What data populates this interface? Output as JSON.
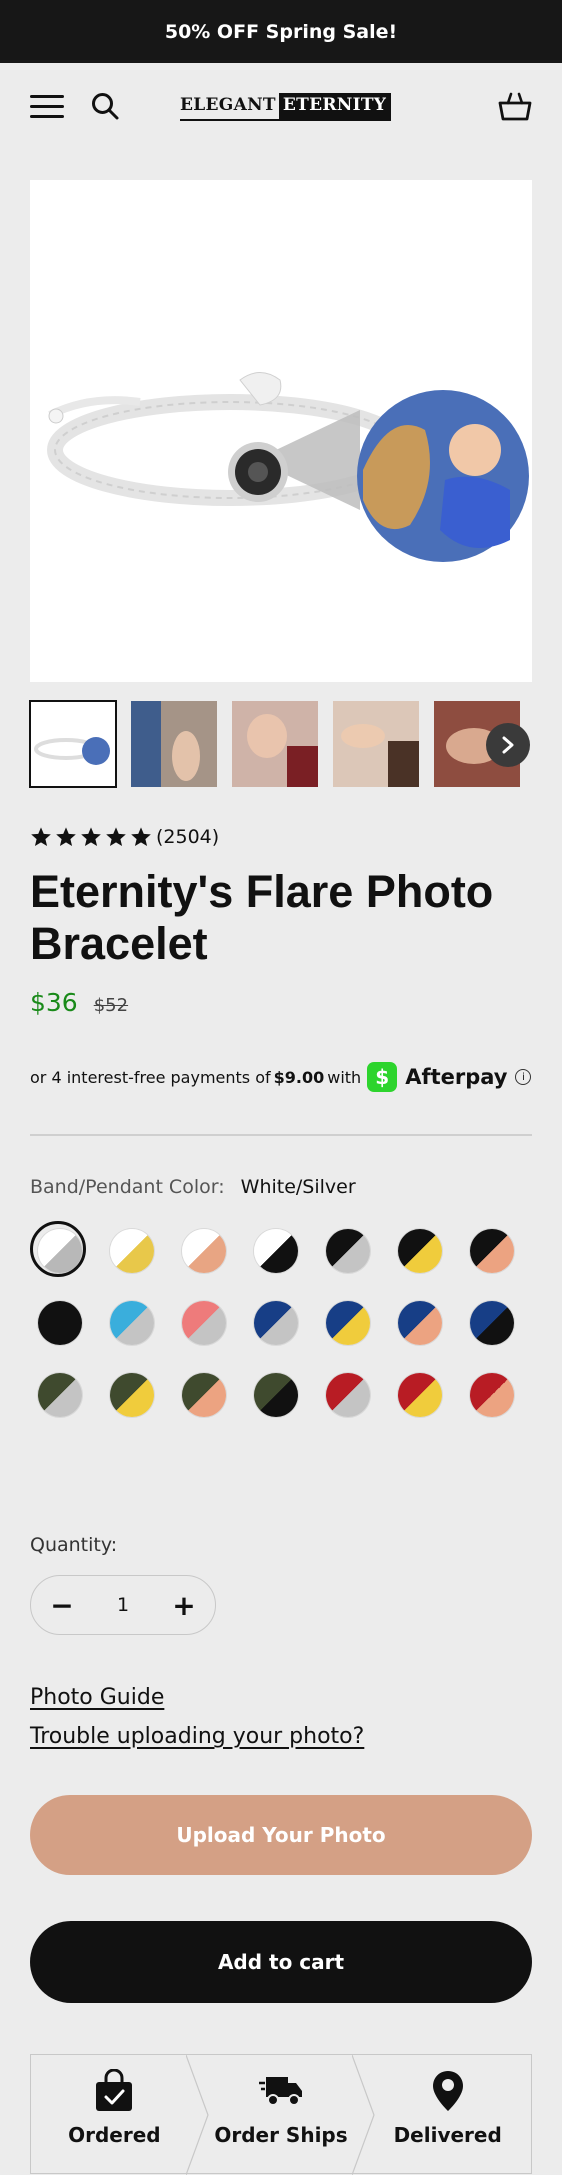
{
  "announcement": "50% OFF Spring Sale!",
  "header": {
    "logo_part1": "ELEGANT",
    "logo_part2": "ETERNITY",
    "icons": [
      "menu-icon",
      "search-icon",
      "cart-icon"
    ]
  },
  "product": {
    "rating_stars": 5,
    "review_count": "(2504)",
    "title": "Eternity's Flare Photo Bracelet",
    "price": "$36",
    "compare_price": "$52"
  },
  "afterpay": {
    "text_before": "or 4 interest-free payments of",
    "amount": "$9.00",
    "text_with": "with",
    "badge_symbol": "$",
    "brand": "Afterpay",
    "info_symbol": "i"
  },
  "option": {
    "label": "Band/Pendant Color:",
    "selected_value": "White/Silver",
    "swatches": [
      {
        "c1": "#ffffff",
        "c2": "#b8b8b8"
      },
      {
        "c1": "#ffffff",
        "c2": "#e8c84a"
      },
      {
        "c1": "#ffffff",
        "c2": "#e8a583"
      },
      {
        "c1": "#ffffff",
        "c2": "#111111"
      },
      {
        "c1": "#111111",
        "c2": "#c4c4c4"
      },
      {
        "c1": "#111111",
        "c2": "#f0cc3c"
      },
      {
        "c1": "#111111",
        "c2": "#eca381"
      },
      {
        "c1": "#111111",
        "c2": "#111111"
      },
      {
        "c1": "#3aaedc",
        "c2": "#c4c4c4"
      },
      {
        "c1": "#ee7b7b",
        "c2": "#c4c4c4"
      },
      {
        "c1": "#173e86",
        "c2": "#c4c4c4"
      },
      {
        "c1": "#173e86",
        "c2": "#f0cc3c"
      },
      {
        "c1": "#173e86",
        "c2": "#eca381"
      },
      {
        "c1": "#173e86",
        "c2": "#111111"
      },
      {
        "c1": "#3f4a2e",
        "c2": "#c4c4c4"
      },
      {
        "c1": "#3f4a2e",
        "c2": "#f0cc3c"
      },
      {
        "c1": "#3f4a2e",
        "c2": "#eca381"
      },
      {
        "c1": "#3f4a2e",
        "c2": "#111111"
      },
      {
        "c1": "#b81c24",
        "c2": "#c4c4c4"
      },
      {
        "c1": "#b81c24",
        "c2": "#f0cc3c"
      },
      {
        "c1": "#b81c24",
        "c2": "#eca381"
      }
    ]
  },
  "quantity": {
    "label": "Quantity:",
    "value": "1",
    "minus": "−",
    "plus": "+"
  },
  "links": {
    "photo_guide": "Photo Guide",
    "trouble": "Trouble uploading your photo?"
  },
  "buttons": {
    "upload": "Upload Your Photo",
    "add_to_cart": "Add to cart"
  },
  "steps": [
    {
      "label": "Ordered",
      "icon": "shopping-bag-check-icon"
    },
    {
      "label": "Order Ships",
      "icon": "delivery-truck-icon"
    },
    {
      "label": "Delivered",
      "icon": "map-pin-icon"
    }
  ],
  "colors": {
    "announcement_bg": "#171717",
    "page_bg": "#ececec",
    "price_green": "#1a8a1a",
    "upload_button": "#d4a085",
    "cart_button": "#111111",
    "afterpay_green": "#2dd42d"
  }
}
